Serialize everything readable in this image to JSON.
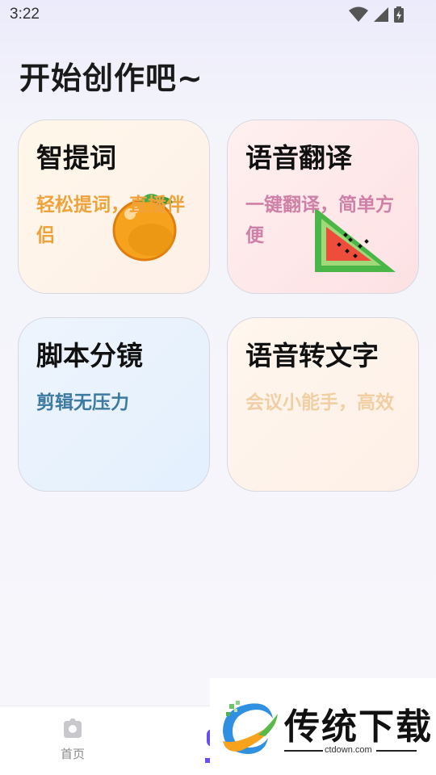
{
  "status_bar": {
    "time": "3:22",
    "icons": [
      "wifi-icon",
      "signal-icon",
      "battery-charging-icon"
    ]
  },
  "page": {
    "title": "开始创作吧~"
  },
  "cards": [
    {
      "title": "智提词",
      "subtitle": "轻松提词，直播伴侣",
      "icon": "orange-icon"
    },
    {
      "title": "语音翻译",
      "subtitle": "一键翻译，简单方便",
      "icon": "watermelon-icon"
    },
    {
      "title": "脚本分镜",
      "subtitle": "剪辑无压力"
    },
    {
      "title": "语音转文字",
      "subtitle": "会议小能手，高效"
    }
  ],
  "tabbar": {
    "home_label": "首页",
    "home_icon": "home-icon"
  },
  "watermark": {
    "brand": "传统下载",
    "url": "ctdown.com"
  },
  "colors": {
    "card1_sub": "#f0a23a",
    "card2_sub": "#d07fa6",
    "card3_sub": "#3c7aa1",
    "card4_sub": "#f1cfa3",
    "accent": "#6a4df0"
  }
}
